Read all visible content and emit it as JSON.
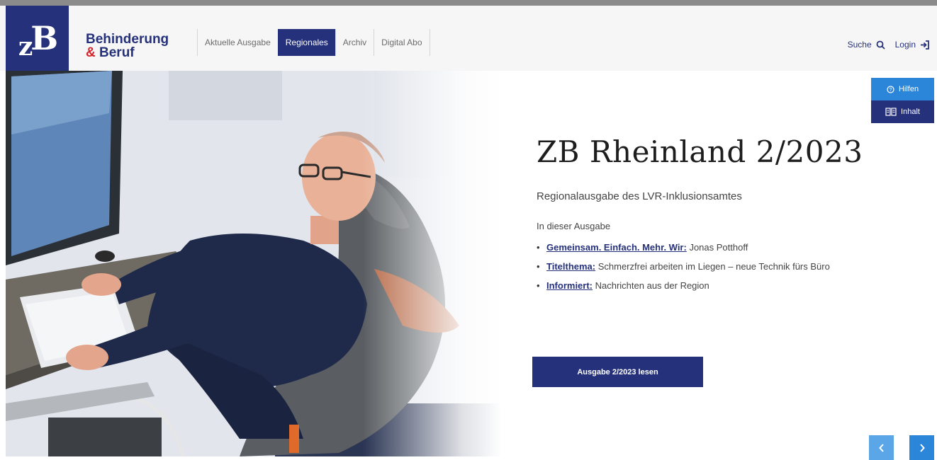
{
  "logo": {
    "text": "ZB"
  },
  "brand": {
    "line1": "Behinderung",
    "line2_amp": "&",
    "line2": " Beruf"
  },
  "nav": {
    "items": [
      {
        "label": "Aktuelle Ausgabe"
      },
      {
        "label": "Regionales",
        "active": true
      },
      {
        "label": "Archiv"
      },
      {
        "label": "Digital Abo"
      }
    ]
  },
  "tools": {
    "search_label": "Suche",
    "login_label": "Login"
  },
  "side": {
    "hilfen_label": "Hilfen",
    "inhalt_label": "Inhalt"
  },
  "hero": {
    "title": "ZB Rheinland 2/2023",
    "subtitle": "Regionalausgabe des LVR-Inklusionsamtes",
    "in_dieser": "In dieser Ausgabe",
    "items": [
      {
        "link": "Gemeinsam. Einfach. Mehr. Wir:",
        "text": " Jonas Potthoff"
      },
      {
        "link": "Titelthema:",
        "text": " Schmerzfrei arbeiten im Liegen – neue Technik fürs Büro"
      },
      {
        "link": "Informiert:",
        "text": " Nachrichten aus der Region"
      }
    ],
    "read_button": "Ausgabe 2/2023 lesen"
  },
  "colors": {
    "brand_navy": "#25317a",
    "accent_blue": "#2b86d9",
    "ampersand_red": "#d6232a"
  },
  "icons": [
    "search-icon",
    "login-icon",
    "help-icon",
    "book-icon",
    "chevron-left-icon",
    "chevron-right-icon"
  ]
}
